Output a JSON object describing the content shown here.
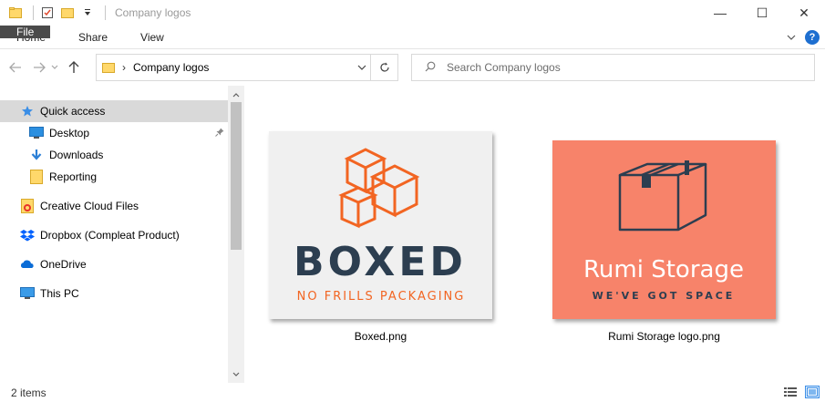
{
  "window": {
    "title": "Company logos",
    "controls": {
      "minimize": "—",
      "maximize": "☐",
      "close": "✕"
    }
  },
  "ribbon": {
    "tabs": [
      "File",
      "Home",
      "Share",
      "View"
    ],
    "help": "?"
  },
  "address": {
    "path": [
      "Company logos"
    ],
    "separator": "›"
  },
  "search": {
    "placeholder": "Search Company logos"
  },
  "nav": {
    "items": [
      {
        "label": "Quick access",
        "icon": "star-icon",
        "selected": true
      },
      {
        "label": "Desktop",
        "icon": "desktop-icon",
        "pinned": true
      },
      {
        "label": "Downloads",
        "icon": "download-icon"
      },
      {
        "label": "Reporting",
        "icon": "folder-icon"
      },
      {
        "label": "Creative Cloud Files",
        "icon": "creative-cloud-icon"
      },
      {
        "label": "Dropbox (Compleat Product)",
        "icon": "dropbox-icon"
      },
      {
        "label": "OneDrive",
        "icon": "onedrive-icon"
      },
      {
        "label": "This PC",
        "icon": "pc-icon"
      }
    ]
  },
  "files": [
    {
      "name": "Boxed.png",
      "logo": {
        "word": "BOXED",
        "tagline": "NO FRILLS PACKAGING",
        "bg": "#f0f0f0",
        "accent": "#f26522",
        "text_color": "#2c3e50"
      }
    },
    {
      "name": "Rumi Storage logo.png",
      "logo": {
        "word": "Rumi Storage",
        "tagline": "WE'VE GOT SPACE",
        "bg": "#f7836a",
        "accent": "#2c3e50",
        "text_color": "#ffffff"
      }
    }
  ],
  "status": {
    "item_count": "2 items"
  },
  "colors": {
    "file_tab_bg": "#4a4a4a",
    "selected_nav_bg": "#d9d9d9",
    "help_blue": "#1e6fd0"
  }
}
